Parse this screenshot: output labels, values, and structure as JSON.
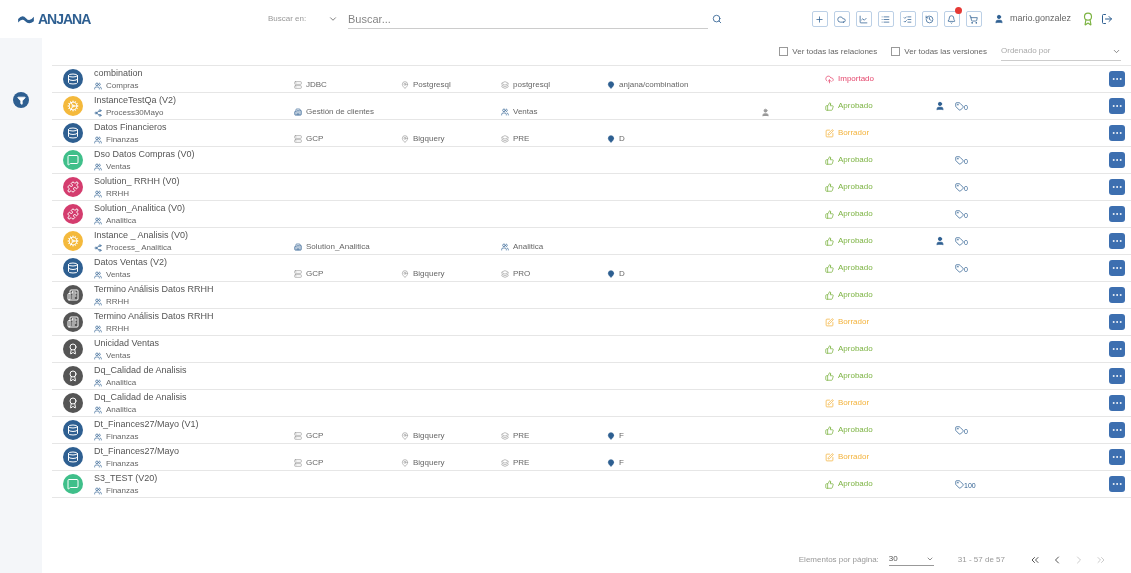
{
  "header": {
    "logo": "ANJANA",
    "search_scope": {
      "label": "Buscar en:"
    },
    "search": {
      "placeholder": "Buscar..."
    },
    "notifications": true,
    "user": "mario.gonzalez"
  },
  "filters": {
    "all_relations": {
      "label": "Ver todas las relaciones",
      "checked": false
    },
    "all_versions": {
      "label": "Ver todas las versiones",
      "checked": false
    },
    "sort": {
      "placeholder": "Ordenado por"
    }
  },
  "rows": [
    {
      "kind": "dataset",
      "name": "combination",
      "domain": {
        "kind": "domain",
        "text": "Compras"
      },
      "col_2": {
        "kind": "system",
        "text": "JDBC"
      },
      "col_3": "Postgresql",
      "col_4": {
        "kind": "env",
        "text": "postgresql"
      },
      "col_5": "anjana/combination",
      "user_icon": false,
      "status": {
        "kind": "imported",
        "label": "Importado"
      },
      "owner_icon": false
    },
    {
      "kind": "process",
      "name": "InstanceTestQa  (V2)",
      "domain": {
        "kind": "process",
        "text": "Process30Mayo"
      },
      "col_2": {
        "kind": "solution",
        "text": "Gestión de clientes"
      },
      "col_4": {
        "kind": "domain",
        "text": "Ventas"
      },
      "user_icon": true,
      "status": {
        "kind": "approved",
        "label": "Aprobado"
      },
      "owner_icon": true,
      "count": "0"
    },
    {
      "kind": "dataset",
      "name": "Datos Financieros",
      "domain": {
        "kind": "domain",
        "text": "Finanzas"
      },
      "col_2": {
        "kind": "system",
        "text": "GCP"
      },
      "col_3": "Bigquery",
      "col_4": {
        "kind": "env",
        "text": "PRE"
      },
      "col_5": "D",
      "user_icon": false,
      "status": {
        "kind": "draft",
        "label": "Borrador"
      },
      "owner_icon": false
    },
    {
      "kind": "dso",
      "name": "Dso Datos Compras  (V0)",
      "domain": {
        "kind": "domain",
        "text": "Ventas"
      },
      "user_icon": false,
      "status": {
        "kind": "approved",
        "label": "Aprobado"
      },
      "owner_icon": false,
      "count": "0"
    },
    {
      "kind": "solution",
      "name": "Solution_ RRHH  (V0)",
      "domain": {
        "kind": "domain",
        "text": "RRHH"
      },
      "user_icon": false,
      "status": {
        "kind": "approved",
        "label": "Aprobado"
      },
      "owner_icon": false,
      "count": "0"
    },
    {
      "kind": "solution",
      "name": "Solution_Analitica  (V0)",
      "domain": {
        "kind": "domain",
        "text": "Analitica"
      },
      "user_icon": false,
      "status": {
        "kind": "approved",
        "label": "Aprobado"
      },
      "owner_icon": false,
      "count": "0"
    },
    {
      "kind": "process",
      "name": "Instance _ Analisis  (V0)",
      "domain": {
        "kind": "process",
        "text": "Process_ Analitica"
      },
      "col_2": {
        "kind": "solution",
        "text": "Solution_Analitica"
      },
      "col_4": {
        "kind": "domain",
        "text": "Analitica"
      },
      "user_icon": false,
      "status": {
        "kind": "approved",
        "label": "Aprobado"
      },
      "owner_icon": true,
      "count": "0"
    },
    {
      "kind": "dataset",
      "name": "Datos Ventas  (V2)",
      "domain": {
        "kind": "domain",
        "text": "Ventas"
      },
      "col_2": {
        "kind": "system",
        "text": "GCP"
      },
      "col_3": "Bigquery",
      "col_4": {
        "kind": "env",
        "text": "PRO"
      },
      "col_5": "D",
      "user_icon": false,
      "status": {
        "kind": "approved",
        "label": "Aprobado"
      },
      "owner_icon": false,
      "count": "0"
    },
    {
      "kind": "term",
      "name": "Termino  Análisis Datos RRHH",
      "domain": {
        "kind": "domain",
        "text": "RRHH"
      },
      "user_icon": false,
      "status": {
        "kind": "approved",
        "label": "Aprobado"
      },
      "owner_icon": false
    },
    {
      "kind": "term",
      "name": "Termino  Análisis Datos RRHH",
      "domain": {
        "kind": "domain",
        "text": "RRHH"
      },
      "user_icon": false,
      "status": {
        "kind": "draft",
        "label": "Borrador"
      },
      "owner_icon": false
    },
    {
      "kind": "quality",
      "name": "Unicidad Ventas",
      "domain": {
        "kind": "domain",
        "text": "Ventas"
      },
      "user_icon": false,
      "status": {
        "kind": "approved",
        "label": "Aprobado"
      },
      "owner_icon": false
    },
    {
      "kind": "quality",
      "name": "Dq_Calidad de Analisis",
      "domain": {
        "kind": "domain",
        "text": "Analitica"
      },
      "user_icon": false,
      "status": {
        "kind": "approved",
        "label": "Aprobado"
      },
      "owner_icon": false
    },
    {
      "kind": "quality",
      "name": "Dq_Calidad de Analisis",
      "domain": {
        "kind": "domain",
        "text": "Analitica"
      },
      "user_icon": false,
      "status": {
        "kind": "draft",
        "label": "Borrador"
      },
      "owner_icon": false
    },
    {
      "kind": "dataset",
      "name": "Dt_Finances27/Mayo  (V1)",
      "domain": {
        "kind": "domain",
        "text": "Finanzas"
      },
      "col_2": {
        "kind": "system",
        "text": "GCP"
      },
      "col_3": "Bigquery",
      "col_4": {
        "kind": "env",
        "text": "PRE"
      },
      "col_5": "F",
      "user_icon": false,
      "status": {
        "kind": "approved",
        "label": "Aprobado"
      },
      "owner_icon": false,
      "count": "0"
    },
    {
      "kind": "dataset",
      "name": "Dt_Finances27/Mayo",
      "domain": {
        "kind": "domain",
        "text": "Finanzas"
      },
      "col_2": {
        "kind": "system",
        "text": "GCP"
      },
      "col_3": "Bigquery",
      "col_4": {
        "kind": "env",
        "text": "PRE"
      },
      "col_5": "F",
      "user_icon": false,
      "status": {
        "kind": "draft",
        "label": "Borrador"
      },
      "owner_icon": false
    },
    {
      "kind": "dso",
      "name": "S3_TEST  (V20)",
      "domain": {
        "kind": "domain",
        "text": "Finanzas"
      },
      "user_icon": false,
      "status": {
        "kind": "approved",
        "label": "Aprobado"
      },
      "owner_icon": false,
      "count": "100"
    }
  ],
  "pagination": {
    "per_page_label": "Elementos por página:",
    "per_page": "30",
    "range": "31 - 57 de 57"
  }
}
